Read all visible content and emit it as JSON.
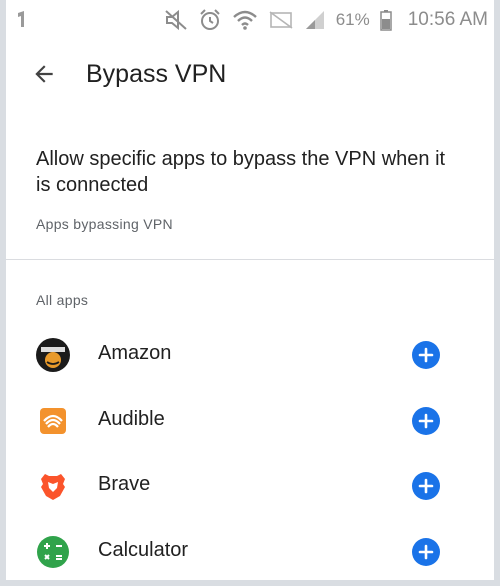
{
  "status_bar": {
    "battery_percent": "61%",
    "time": "10:56 AM",
    "icons": [
      "signal-indicator-icon",
      "mute-icon",
      "alarm-icon",
      "wifi-icon",
      "no-sim-icon",
      "cell-signal-icon",
      "battery-icon"
    ]
  },
  "header": {
    "title": "Bypass VPN",
    "back_icon": "arrow-back-icon"
  },
  "description": "Allow specific apps to bypass the VPN when it is connected",
  "sections": {
    "bypassing_label": "Apps bypassing VPN",
    "all_apps_label": "All apps"
  },
  "apps": [
    {
      "name": "Amazon",
      "icon": "amazon-app-icon",
      "action_icon": "add-circle-icon"
    },
    {
      "name": "Audible",
      "icon": "audible-app-icon",
      "action_icon": "add-circle-icon"
    },
    {
      "name": "Brave",
      "icon": "brave-app-icon",
      "action_icon": "add-circle-icon"
    },
    {
      "name": "Calculator",
      "icon": "calculator-app-icon",
      "action_icon": "add-circle-icon"
    }
  ],
  "colors": {
    "accent_add_button": "#1a73e8",
    "status_bar_text": "#8c8c8c",
    "audible_orange": "#f3922d",
    "brave_orange": "#fb542b",
    "calculator_green": "#30a34b"
  }
}
